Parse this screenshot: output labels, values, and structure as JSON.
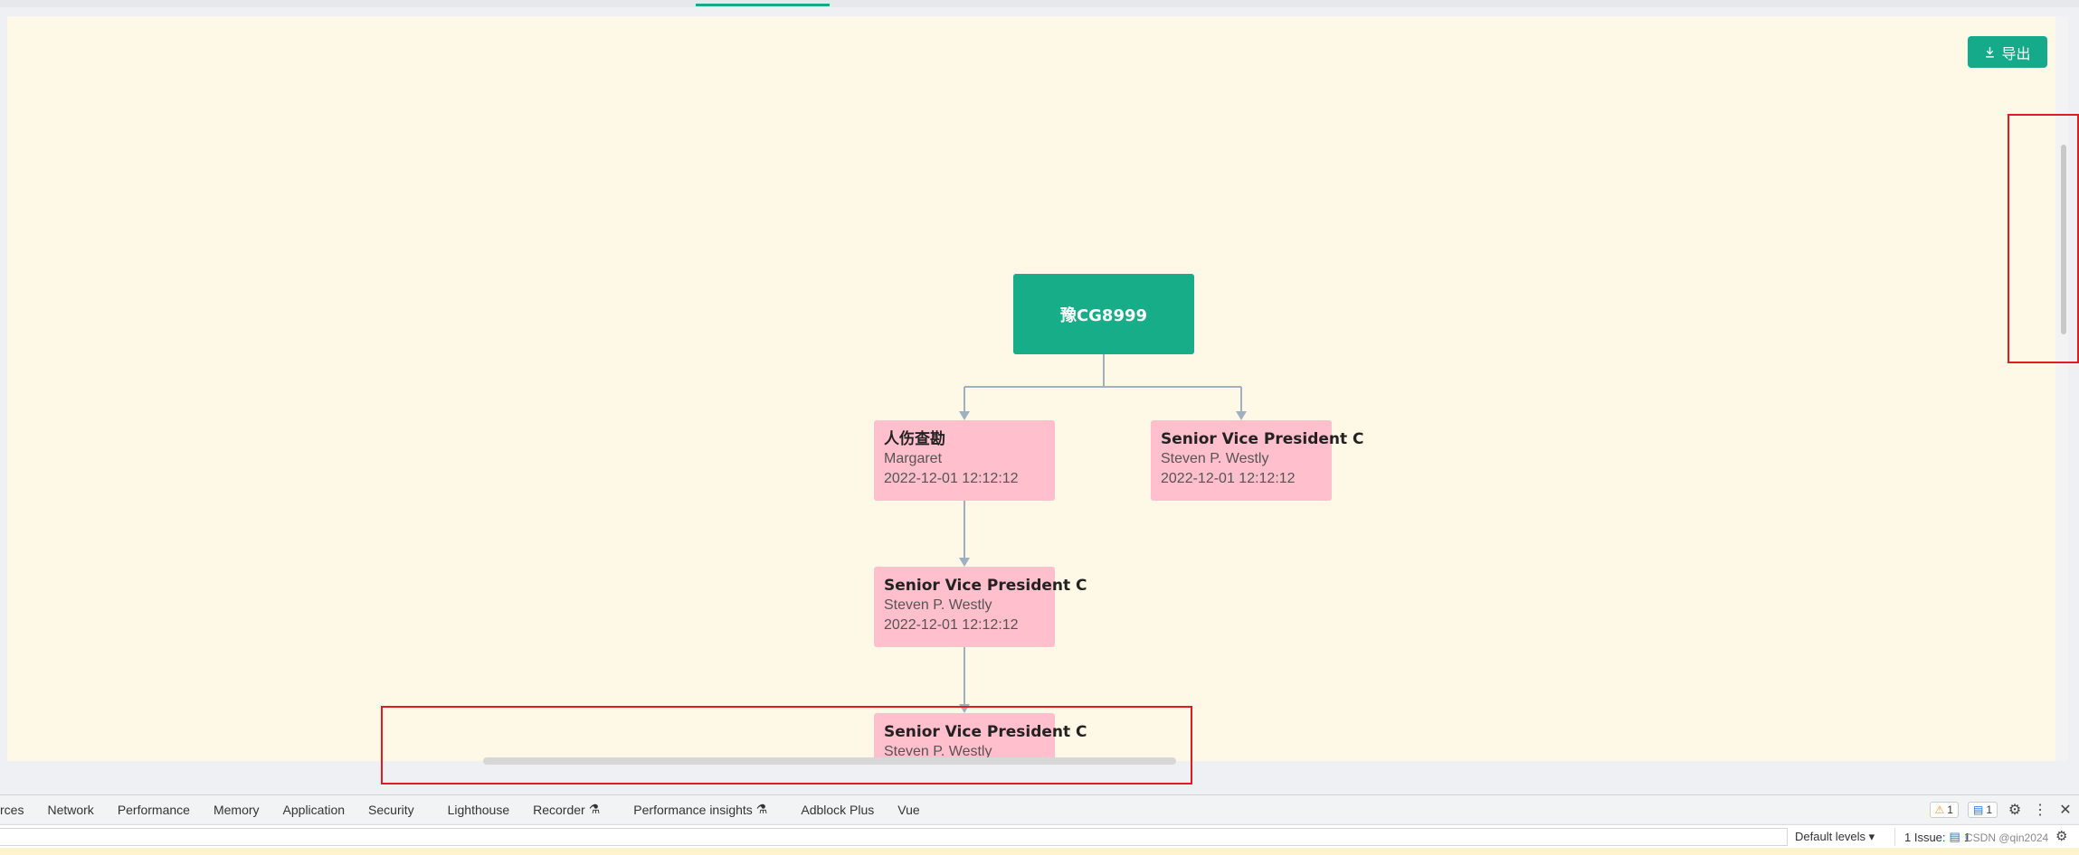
{
  "toolbar": {
    "export_label": "导出"
  },
  "org_chart": {
    "root": {
      "label": "豫CG8999"
    },
    "nodes": [
      {
        "title": "人伤查勘",
        "name": "Margaret",
        "time": "2022-12-01 12:12:12"
      },
      {
        "title": "Senior Vice President C",
        "name": "Steven P. Westly",
        "time": "2022-12-01 12:12:12"
      },
      {
        "title": "Senior Vice President C",
        "name": "Steven P. Westly",
        "time": "2022-12-01 12:12:12"
      },
      {
        "title": "Senior Vice President C",
        "name": "Steven P. Westly",
        "time": ""
      }
    ]
  },
  "devtools": {
    "tabs": [
      "rces",
      "Network",
      "Performance",
      "Memory",
      "Application",
      "Security",
      "Lighthouse",
      "Recorder",
      "Performance insights",
      "Adblock Plus",
      "Vue"
    ],
    "warnings_count": "1",
    "messages_count": "1",
    "default_levels": "Default levels",
    "issues_label": "1 Issue:",
    "issues_count": "1",
    "watermark": "CSDN @qin2024"
  },
  "colors": {
    "accent": "#14aa8a",
    "node_pink": "#ffbfcd",
    "canvas_bg": "#fef9e6",
    "annotation": "#e01b24"
  }
}
